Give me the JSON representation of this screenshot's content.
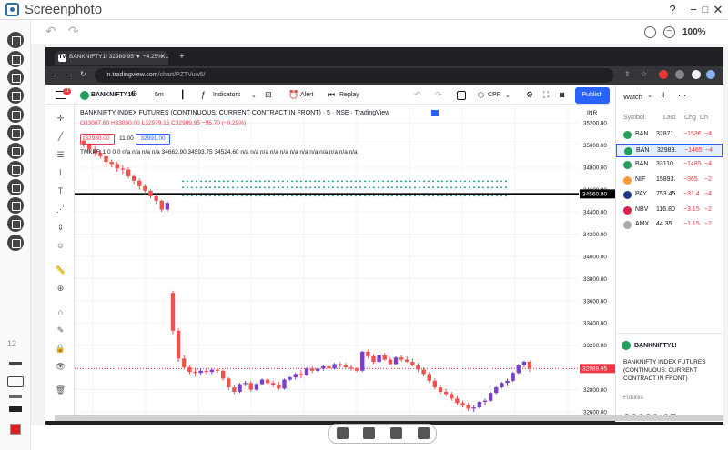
{
  "app": {
    "title": "Screenphoto",
    "zoom": "100%",
    "font_size": "12",
    "color": "#e02020"
  },
  "window": {
    "help": "?",
    "minimize": "−",
    "maximize": "□",
    "close": "✕"
  },
  "browser": {
    "tab_title": "BANKNIFTY1! 32989.95 ▼ −4.25%…",
    "url_host": "in.tradingview.com",
    "url_path": "/chart/PZTVuw5/"
  },
  "tv": {
    "symbol": "BANKNIFTY1!",
    "interval": "5m",
    "indicators": "Indicators",
    "alert": "Alert",
    "replay": "Replay",
    "cpr": "CPR",
    "publish": "Publish",
    "header": "BANKNIFTY INDEX FUTURES (CONTINUOUS: CURRENT CONTRACT IN FRONT) · 5 · NSE · TradingView",
    "ohlc": {
      "o": "O33087.60",
      "h": "H33090.00",
      "l": "L32979.15",
      "c": "C32989.95",
      "chg": "−95.70 (−0.29%)"
    },
    "bid": "32980.00",
    "spread": "11.00",
    "ask": "32991.00",
    "indicator_line": "TMKPR 1 0 0 0  n/a n/a n/a n/a  34662.90 34593.75 34524.60 n/a n/a n/a n/a n/a n/a n/a n/a n/a n/a n/a n/a",
    "currency": "INR",
    "price_ticks": [
      "35200.00",
      "35000.00",
      "34800.00",
      "34600.00",
      "34400.00",
      "34200.00",
      "34000.00",
      "33800.00",
      "33600.00",
      "33400.00",
      "33200.00",
      "33000.00",
      "32800.00",
      "32600.00"
    ],
    "horizontal_line_label": "34560.80",
    "last_price_label": "32989.95"
  },
  "watchlist": {
    "title": "Watch",
    "columns": [
      "Symbol",
      "Last",
      "Chg",
      "Ch"
    ],
    "rows": [
      {
        "sym": "BAN",
        "last": "32871.",
        "chg": "−153€",
        "ch": "−4",
        "icon": "#21a05a"
      },
      {
        "sym": "BAN",
        "last": "32989.",
        "chg": "−1465",
        "ch": "−4",
        "icon": "#21a05a"
      },
      {
        "sym": "BAN",
        "last": "33110.",
        "chg": "−1485",
        "ch": "−4",
        "icon": "#21a05a"
      },
      {
        "sym": "NIF",
        "last": "15893.",
        "chg": "−365.",
        "ch": "−2",
        "icon": "#ff9933"
      },
      {
        "sym": "PAY",
        "last": "753.45",
        "chg": "−31.4",
        "ch": "−4",
        "icon": "#1e3a8a"
      },
      {
        "sym": "NBV",
        "last": "116.80",
        "chg": "−3.15",
        "ch": "−2",
        "icon": "#e11d48"
      },
      {
        "sym": "AMX",
        "last": "44.35",
        "chg": "−1.15",
        "ch": "−2",
        "icon": "#aaa"
      }
    ],
    "detail_symbol": "BANKNIFTY1!",
    "detail_name": "BANKNIFTY INDEX FUTURES (CONTINUOUS: CURRENT CONTRACT IN FRONT)",
    "detail_type": "Futures",
    "detail_price": "32989.95"
  },
  "chart_data": {
    "type": "candlestick",
    "ylim": [
      32600,
      35300
    ],
    "horizontal_line": 34560.8,
    "last_price": 32989.95,
    "candles": [
      [
        35040,
        35080,
        34980,
        35010
      ],
      [
        35010,
        35020,
        34930,
        34960
      ],
      [
        34960,
        34990,
        34900,
        34930
      ],
      [
        34930,
        34950,
        34880,
        34900
      ],
      [
        34900,
        34920,
        34820,
        34850
      ],
      [
        34850,
        34870,
        34800,
        34830
      ],
      [
        34830,
        34850,
        34760,
        34790
      ],
      [
        34790,
        34820,
        34740,
        34780
      ],
      [
        34780,
        34800,
        34700,
        34720
      ],
      [
        34720,
        34740,
        34650,
        34680
      ],
      [
        34680,
        34700,
        34600,
        34630
      ],
      [
        34630,
        34650,
        34560,
        34590
      ],
      [
        34590,
        34600,
        34520,
        34540
      ],
      [
        34540,
        34560,
        34470,
        34500
      ],
      [
        34500,
        34510,
        34400,
        34420
      ],
      [
        34420,
        34500,
        34400,
        34480
      ],
      [
        33670,
        33690,
        33300,
        33330
      ],
      [
        33330,
        33350,
        33050,
        33080
      ],
      [
        33080,
        33110,
        32980,
        33000
      ],
      [
        33000,
        33020,
        32940,
        32960
      ],
      [
        32960,
        32990,
        32920,
        32950
      ],
      [
        32950,
        32990,
        32930,
        32970
      ],
      [
        32970,
        32990,
        32940,
        32960
      ],
      [
        32960,
        32990,
        32940,
        32980
      ],
      [
        32980,
        33000,
        32950,
        32970
      ],
      [
        32970,
        32980,
        32880,
        32900
      ],
      [
        32900,
        32910,
        32800,
        32820
      ],
      [
        32820,
        32840,
        32760,
        32780
      ],
      [
        32780,
        32860,
        32770,
        32850
      ],
      [
        32850,
        32880,
        32830,
        32860
      ],
      [
        32860,
        32880,
        32780,
        32800
      ],
      [
        32800,
        32860,
        32790,
        32850
      ],
      [
        32850,
        32900,
        32840,
        32890
      ],
      [
        32890,
        32900,
        32840,
        32860
      ],
      [
        32860,
        32880,
        32820,
        32840
      ],
      [
        32840,
        32870,
        32800,
        32810
      ],
      [
        32810,
        32900,
        32800,
        32890
      ],
      [
        32890,
        32920,
        32880,
        32910
      ],
      [
        32910,
        32950,
        32890,
        32940
      ],
      [
        32940,
        32980,
        32900,
        32930
      ],
      [
        32930,
        33000,
        32920,
        32990
      ],
      [
        32990,
        33010,
        32950,
        32970
      ],
      [
        32970,
        33000,
        32960,
        32990
      ],
      [
        32990,
        33020,
        32970,
        33010
      ],
      [
        33010,
        33030,
        32980,
        32990
      ],
      [
        32990,
        33040,
        32980,
        33030
      ],
      [
        33030,
        33050,
        33000,
        33020
      ],
      [
        33020,
        33040,
        32990,
        33000
      ],
      [
        33000,
        33020,
        32970,
        32990
      ],
      [
        32990,
        33000,
        32960,
        32970
      ],
      [
        32970,
        33150,
        32960,
        33140
      ],
      [
        33140,
        33160,
        33080,
        33100
      ],
      [
        33100,
        33120,
        33030,
        33050
      ],
      [
        33050,
        33120,
        33040,
        33110
      ],
      [
        33110,
        33130,
        33060,
        33070
      ],
      [
        33070,
        33090,
        33020,
        33030
      ],
      [
        33030,
        33100,
        33020,
        33090
      ],
      [
        33090,
        33110,
        33050,
        33070
      ],
      [
        33070,
        33100,
        33040,
        33050
      ],
      [
        33050,
        33080,
        33010,
        33020
      ],
      [
        33020,
        33040,
        32960,
        32980
      ],
      [
        32980,
        33000,
        32920,
        32940
      ],
      [
        32940,
        32960,
        32860,
        32880
      ],
      [
        32880,
        32900,
        32800,
        32820
      ],
      [
        32820,
        32840,
        32760,
        32780
      ],
      [
        32780,
        32810,
        32740,
        32760
      ],
      [
        32760,
        32780,
        32700,
        32720
      ],
      [
        32720,
        32740,
        32660,
        32680
      ],
      [
        32680,
        32700,
        32640,
        32660
      ],
      [
        32660,
        32680,
        32610,
        32630
      ],
      [
        32630,
        32660,
        32600,
        32640
      ],
      [
        32640,
        32700,
        32630,
        32690
      ],
      [
        32690,
        32720,
        32660,
        32700
      ],
      [
        32700,
        32780,
        32690,
        32770
      ],
      [
        32770,
        32830,
        32760,
        32820
      ],
      [
        32820,
        32870,
        32810,
        32860
      ],
      [
        32860,
        32900,
        32830,
        32880
      ],
      [
        32880,
        32960,
        32870,
        32950
      ],
      [
        32950,
        33030,
        32940,
        33020
      ],
      [
        33020,
        33060,
        33000,
        33050
      ],
      [
        33050,
        33060,
        32960,
        32990
      ]
    ]
  }
}
